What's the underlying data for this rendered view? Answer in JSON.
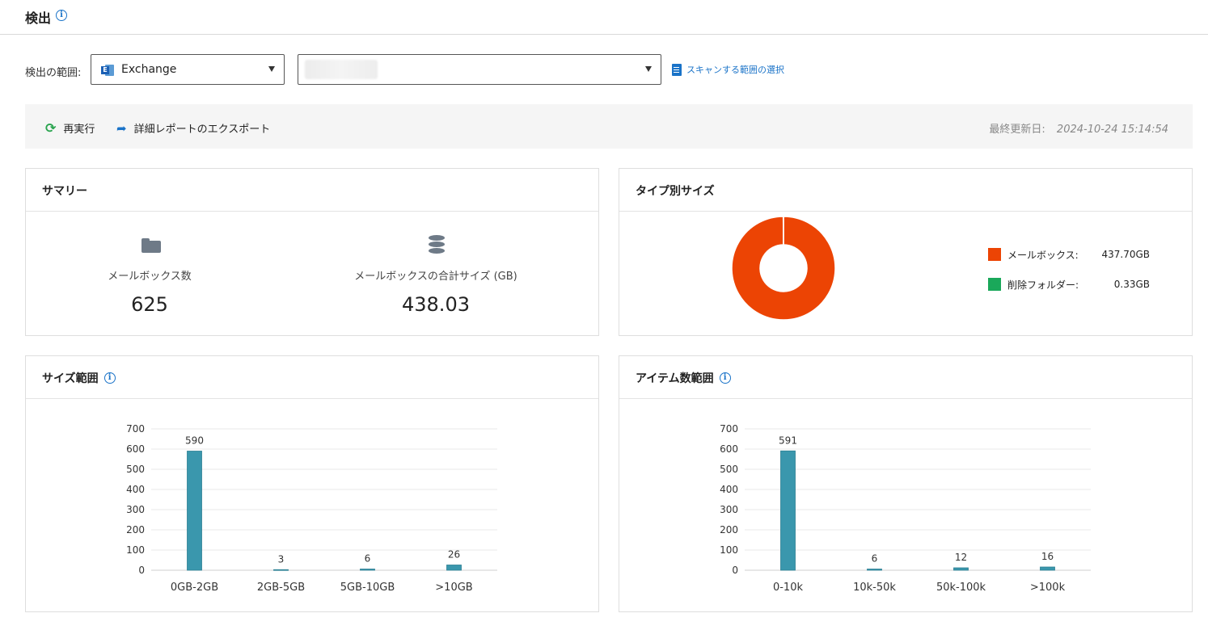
{
  "header": {
    "title": "検出"
  },
  "scope": {
    "label": "検出の範囲:",
    "source_value": "Exchange",
    "scan_link": "スキャンする範囲の選択"
  },
  "toolbar": {
    "rerun_label": "再実行",
    "export_label": "詳細レポートのエクスポート",
    "last_updated_label": "最終更新日:",
    "last_updated_value": "2024-10-24 15:14:54"
  },
  "summary": {
    "title": "サマリー",
    "mailbox_count_label": "メールボックス数",
    "mailbox_count": "625",
    "total_size_label": "メールボックスの合計サイズ (GB)",
    "total_size": "438.03"
  },
  "type_card": {
    "title": "タイプ別サイズ"
  },
  "size_card": {
    "title": "サイズ範囲"
  },
  "items_card": {
    "title": "アイテム数範囲"
  },
  "colors": {
    "accent": "#1a73c8",
    "bar": "#3a97ad",
    "mailbox": "#ec4404",
    "deleted": "#1aa85a"
  },
  "chart_data": [
    {
      "type": "pie",
      "labels": [
        "メールボックス:",
        "削除フォルダー:"
      ],
      "value_labels": [
        "437.70GB",
        "0.33GB"
      ],
      "values": [
        437.7,
        0.33
      ],
      "colors": [
        "#ec4404",
        "#1aa85a"
      ],
      "legend": "right"
    },
    {
      "type": "bar",
      "categories": [
        "0GB-2GB",
        "2GB-5GB",
        "5GB-10GB",
        ">10GB"
      ],
      "values": [
        590,
        3,
        6,
        26
      ],
      "ylim": [
        0,
        700
      ],
      "yticks": [
        0,
        100,
        200,
        300,
        400,
        500,
        600,
        700
      ],
      "grid": true
    },
    {
      "type": "bar",
      "categories": [
        "0-10k",
        "10k-50k",
        "50k-100k",
        ">100k"
      ],
      "values": [
        591,
        6,
        12,
        16
      ],
      "ylim": [
        0,
        700
      ],
      "yticks": [
        0,
        100,
        200,
        300,
        400,
        500,
        600,
        700
      ],
      "grid": true
    }
  ]
}
